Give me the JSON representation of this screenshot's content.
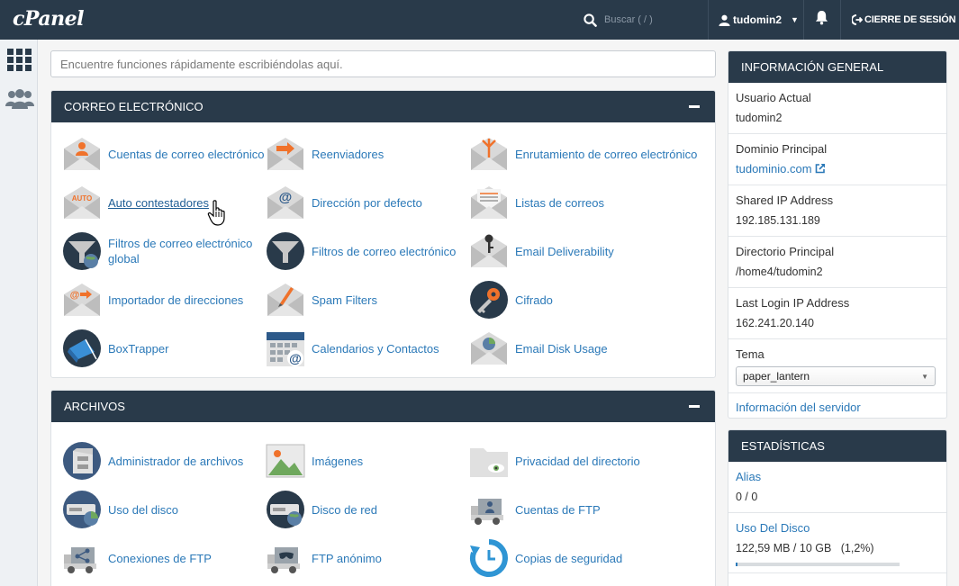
{
  "app": {
    "logo": "cPanel"
  },
  "header": {
    "search_placeholder": "Buscar ( / )",
    "username": "tudomin2",
    "logout_label": "CIERRE DE SESIÓN"
  },
  "quick_search": {
    "placeholder": "Encuentre funciones rápidamente escribiéndolas aquí."
  },
  "email_section": {
    "title": "CORREO ELECTRÓNICO",
    "items": [
      {
        "label": "Cuentas de correo electrónico",
        "icon": "email-accounts-icon"
      },
      {
        "label": "Reenviadores",
        "icon": "forwarders-icon"
      },
      {
        "label": "Enrutamiento de correo electrónico",
        "icon": "email-routing-icon"
      },
      {
        "label": "Auto contestadores",
        "icon": "autoresponders-icon",
        "badge": "AUTO"
      },
      {
        "label": "Dirección por defecto",
        "icon": "default-address-icon"
      },
      {
        "label": "Listas de correos",
        "icon": "mailing-lists-icon"
      },
      {
        "label": "Filtros de correo electrónico global",
        "icon": "global-email-filters-icon"
      },
      {
        "label": "Filtros de correo electrónico",
        "icon": "email-filters-icon"
      },
      {
        "label": "Email Deliverability",
        "icon": "email-deliverability-icon"
      },
      {
        "label": "Importador de direcciones",
        "icon": "address-importer-icon"
      },
      {
        "label": "Spam Filters",
        "icon": "spam-filters-icon"
      },
      {
        "label": "Cifrado",
        "icon": "encryption-icon"
      },
      {
        "label": "BoxTrapper",
        "icon": "boxtrapper-icon"
      },
      {
        "label": "Calendarios y Contactos",
        "icon": "calendars-contacts-icon"
      },
      {
        "label": "Email Disk Usage",
        "icon": "email-disk-usage-icon"
      }
    ]
  },
  "files_section": {
    "title": "ARCHIVOS",
    "items": [
      {
        "label": "Administrador de archivos",
        "icon": "file-manager-icon"
      },
      {
        "label": "Imágenes",
        "icon": "images-icon"
      },
      {
        "label": "Privacidad del directorio",
        "icon": "directory-privacy-icon"
      },
      {
        "label": "Uso del disco",
        "icon": "disk-usage-icon"
      },
      {
        "label": "Disco de red",
        "icon": "web-disk-icon"
      },
      {
        "label": "Cuentas de FTP",
        "icon": "ftp-accounts-icon"
      },
      {
        "label": "Conexiones de FTP",
        "icon": "ftp-connections-icon"
      },
      {
        "label": "FTP anónimo",
        "icon": "anonymous-ftp-icon"
      },
      {
        "label": "Copias de seguridad",
        "icon": "backup-icon"
      }
    ]
  },
  "general_info": {
    "title": "INFORMACIÓN GENERAL",
    "rows": [
      {
        "key": "Usuario Actual",
        "value": "tudomin2"
      },
      {
        "key": "Dominio Principal",
        "value": "tudominio.com"
      },
      {
        "key": "Shared IP Address",
        "value": "192.185.131.189"
      },
      {
        "key": "Directorio Principal",
        "value": "/home4/tudomin2"
      },
      {
        "key": "Last Login IP Address",
        "value": "162.241.20.140"
      },
      {
        "key": "Tema",
        "value": "paper_lantern"
      }
    ],
    "server_info_link": "Información del servidor"
  },
  "stats": {
    "title": "ESTADÍSTICAS",
    "rows": [
      {
        "key": "Alias",
        "value": "0 / 0"
      },
      {
        "key": "Uso Del Disco",
        "value": "122,59 MB / 10 GB   (1,2%)",
        "percent": 1.2
      }
    ]
  },
  "colors": {
    "navy": "#293a4a",
    "link": "#2b79b8",
    "orange": "#f0722b"
  }
}
